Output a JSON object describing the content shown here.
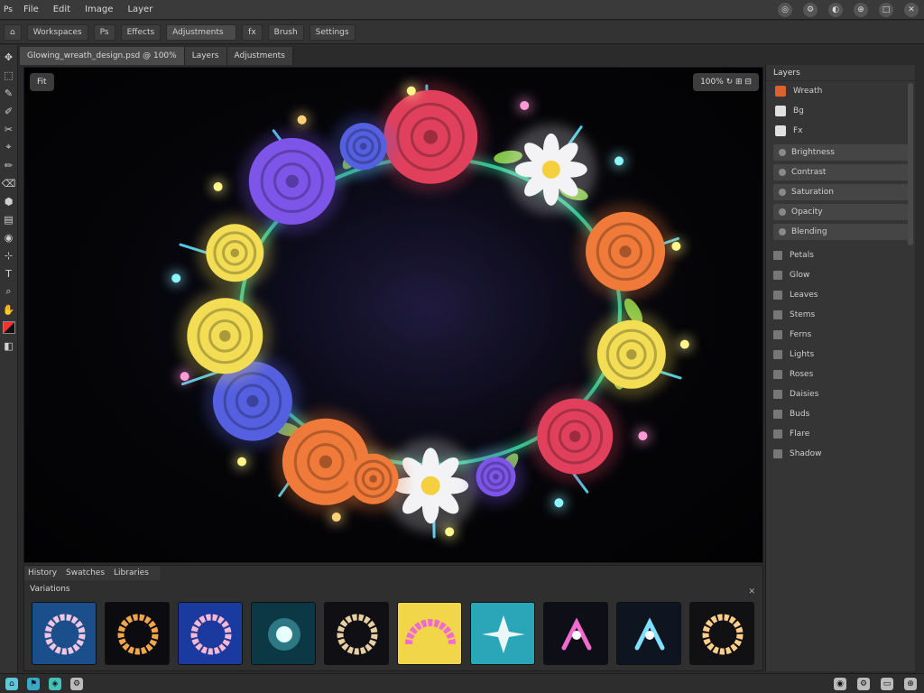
{
  "menubar": {
    "logo": "Ps",
    "items": [
      "File",
      "Edit",
      "Image",
      "Layer"
    ],
    "window_controls": [
      "◎",
      "⚙",
      "◐",
      "⊕",
      "□",
      "✕"
    ]
  },
  "options": {
    "items": [
      "Workspaces",
      "Ps",
      "Effects",
      "Adjustments",
      "fx",
      "Brush",
      "Settings"
    ]
  },
  "doctabs": [
    "Glowing_wreath_design.psd @ 100%",
    "Layers",
    "Adjustments"
  ],
  "toolbar": {
    "tools": [
      "✥",
      "⬚",
      "✎",
      "✐",
      "✂",
      "⌖",
      "✏",
      "⌫",
      "⬢",
      "▤",
      "◉",
      "⊹",
      "T",
      "⌕",
      "✋",
      "⊙",
      "◧"
    ]
  },
  "canvas": {
    "badge": "Fit",
    "info": "100% ↻ ⊞ ⊟",
    "colors": {
      "red": "#e0405c",
      "purple": "#7d55e8",
      "yellow": "#f2dd55",
      "orange": "#ef7a3a",
      "white": "#f3f3f6",
      "blue": "#5560e0",
      "leaf": "#37d19a",
      "fern": "#4fc9e6"
    }
  },
  "rightpanel": {
    "title": "Layers",
    "layer_top": "Wreath",
    "rows": [
      {
        "icon": "image-icon",
        "label": "Bg"
      },
      {
        "icon": "mask-icon",
        "label": "Fx"
      }
    ],
    "props": [
      "Brightness",
      "Contrast",
      "Saturation",
      "Opacity",
      "Blending"
    ],
    "layers": [
      "Petals",
      "Glow",
      "Leaves",
      "Stems",
      "Ferns",
      "Lights",
      "Roses",
      "Daisies",
      "Buds",
      "Flare",
      "Shadow"
    ]
  },
  "bottompanel": {
    "tabs": [
      "History",
      "Swatches",
      "Libraries"
    ],
    "title": "Variations",
    "close": "✕",
    "thumbs": [
      {
        "bg": "#1a4f8c",
        "ring": "#f2c6e0",
        "kind": "wreath"
      },
      {
        "bg": "#0c0c10",
        "ring": "#f2a64a",
        "kind": "wreath"
      },
      {
        "bg": "#1b3aa0",
        "ring": "#ffb8d0",
        "kind": "wreath"
      },
      {
        "bg": "#0b3844",
        "ring": "#69f3ff",
        "kind": "glow"
      },
      {
        "bg": "#101014",
        "ring": "#e6cfa3",
        "kind": "wreath"
      },
      {
        "bg": "#f2d64a",
        "ring": "#f06ad0",
        "kind": "arch"
      },
      {
        "bg": "#2aa6b8",
        "ring": "#ffffff",
        "kind": "star"
      },
      {
        "bg": "#0e0e16",
        "ring": "#f06ad0",
        "kind": "sprig"
      },
      {
        "bg": "#0e1420",
        "ring": "#7fe1ff",
        "kind": "sprig"
      },
      {
        "bg": "#111114",
        "ring": "#ffcf8a",
        "kind": "wreath"
      }
    ]
  },
  "statusbar": {
    "left_icons": [
      "⌂",
      "⚑",
      "◈",
      "⚙"
    ],
    "right_icons": [
      "◉",
      "⚙",
      "▭",
      "⊕"
    ]
  }
}
